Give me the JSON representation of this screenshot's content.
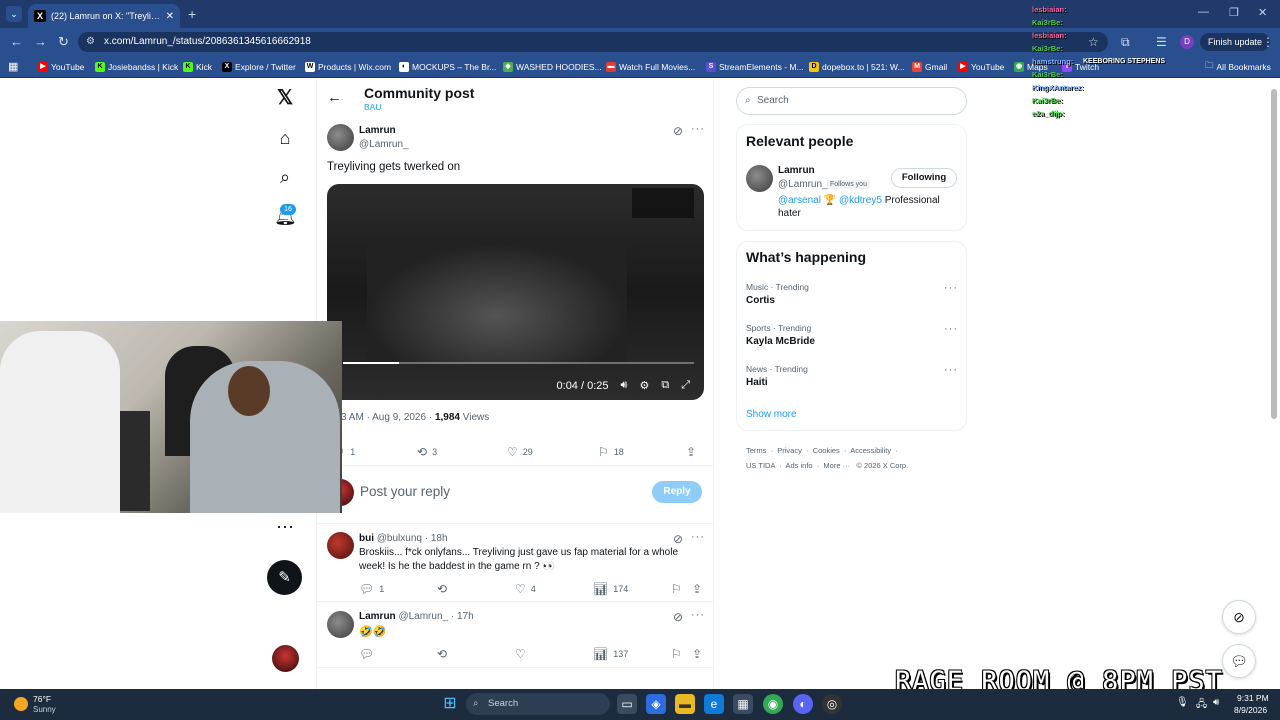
{
  "browser": {
    "tab_title": "(22) Lamrun on X: \"Treyliving g",
    "tab_close": "✕",
    "new_tab": "+",
    "url": "x.com/Lamrun_/status/2086361345616662918",
    "finish_update": "Finish update",
    "profile_initial": "D",
    "bookmarks": [
      {
        "label": "YouTube",
        "icon_color": "#ff0000",
        "icon": "▶"
      },
      {
        "label": "Josiebandss | Kick",
        "icon_color": "#53fc18",
        "icon": "K"
      },
      {
        "label": "Kick",
        "icon_color": "#53fc18",
        "icon": "K"
      },
      {
        "label": "Explore / Twitter",
        "icon_color": "#000000",
        "icon": "X"
      },
      {
        "label": "Products | Wix.com",
        "icon_color": "#ffffff",
        "icon": "W"
      },
      {
        "label": "MOCKUPS – The Br...",
        "icon_color": "#ffffff",
        "icon": "◐"
      },
      {
        "label": "WASHED HOODIES...",
        "icon_color": "#4caf50",
        "icon": "◆"
      },
      {
        "label": "Watch Full Movies...",
        "icon_color": "#e53935",
        "icon": "▬"
      },
      {
        "label": "StreamElements - M...",
        "icon_color": "#5a4fcf",
        "icon": "S"
      },
      {
        "label": "dopebox.to | 521: W...",
        "icon_color": "#f5c518",
        "icon": "D"
      },
      {
        "label": "Gmail",
        "icon_color": "#ea4335",
        "icon": "M"
      },
      {
        "label": "YouTube",
        "icon_color": "#ff0000",
        "icon": "▶"
      },
      {
        "label": "Maps",
        "icon_color": "#34a853",
        "icon": "◉"
      },
      {
        "label": "Twitch",
        "icon_color": "#9146ff",
        "icon": "T"
      }
    ],
    "all_bookmarks": "All Bookmarks"
  },
  "header": {
    "title": "Community post",
    "subtitle": "BAU"
  },
  "post": {
    "author_name": "Lamrun",
    "author_handle": "@Lamrun_",
    "text": "Treyliving gets twerked on",
    "video_time": "0:04 / 0:25",
    "video_progress": 0.16,
    "meta_time": "3 AM · Aug 9, 2026 · ",
    "views_count": "1,984",
    "views_label": " Views",
    "replies": "1",
    "reposts": "3",
    "likes": "29",
    "bookmarks": "18"
  },
  "reply_box": {
    "placeholder": "Post your reply",
    "button": "Reply"
  },
  "replies": [
    {
      "name": "bui",
      "handle": "@bulxunq · 18h",
      "text_line1": "Broskiis... f*ck onlyfans... Treyliving just gave us fap material for a whole",
      "text_line2": "week! Is he the baddest in the game rn ? 👀",
      "replies": "1",
      "likes": "4",
      "views": "174"
    },
    {
      "name": "Lamrun",
      "handle": "@Lamrun_ · 17h",
      "text_line1": "🤣🤣",
      "views": "137"
    }
  ],
  "sidebar": {
    "search_placeholder": "Search",
    "relevant_title": "Relevant people",
    "person_name": "Lamrun",
    "person_handle": "@Lamrun_",
    "follows_you": "Follows you",
    "following_btn": "Following",
    "bio_link1": "@arsenal",
    "bio_trophy": "🏆",
    "bio_link2": "@kdtrey5",
    "bio_text": " Professional",
    "bio_text2": "hater",
    "happening_title": "What’s happening",
    "trends": [
      {
        "category": "Music · Trending",
        "name": "Cortis"
      },
      {
        "category": "Sports · Trending",
        "name": "Kayla McBride"
      },
      {
        "category": "News · Trending",
        "name": "Haiti"
      }
    ],
    "show_more": "Show more",
    "footer_line1": [
      "Terms",
      "Privacy",
      "Cookies",
      "Accessibility"
    ],
    "footer_line2": [
      "US TIDA",
      "Ads info",
      "More ···",
      "© 2026 X Corp."
    ]
  },
  "nav": {
    "notifications_badge": "16"
  },
  "overlay": {
    "rage_room": "RAGE ROOM @ 8PM PST",
    "chat_title": "KEEBORING STEPHENS",
    "chat_lines": [
      {
        "name": "lesbiaian:",
        "color": "#ff5f9e"
      },
      {
        "name": "Kai3rBe:",
        "color": "#4fd14f"
      },
      {
        "name": "lesbiaian:",
        "color": "#ff5f9e"
      },
      {
        "name": "Kai3rBe:",
        "color": "#4fd14f"
      },
      {
        "name": "hamstrung:",
        "color": "#7fb6ff"
      },
      {
        "name": "Kai3rBe:",
        "color": "#4fd14f"
      },
      {
        "name": "KingXAntarez:",
        "color": "#7fb6ff"
      },
      {
        "name": "Kai3rBe:",
        "color": "#4fd14f"
      },
      {
        "name": "e2a_dijp:",
        "color": "#4fd14f"
      }
    ]
  },
  "taskbar": {
    "temp": "76°F",
    "weather": "Sunny",
    "search": "Search",
    "time": "9:31 PM",
    "date": "8/9/2026"
  },
  "colors": {
    "accent": "#1d9bf0",
    "browser_frame": "#2a4f8e",
    "taskbar": "#1c2b3d"
  }
}
